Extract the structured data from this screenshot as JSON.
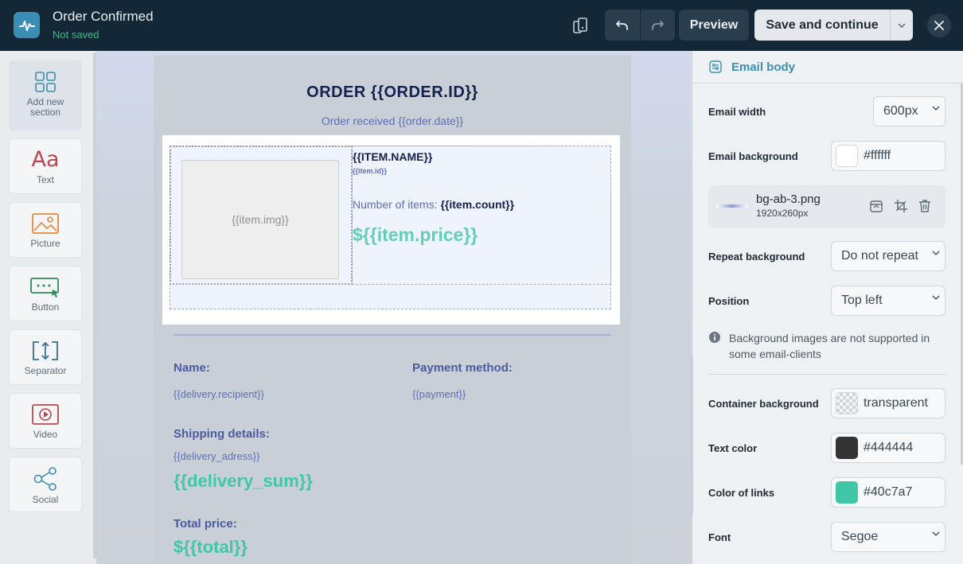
{
  "header": {
    "title": "Order Confirmed",
    "status": "Not saved",
    "preview_label": "Preview",
    "save_label": "Save and continue"
  },
  "sidebar": {
    "items": [
      {
        "label": "Add new section",
        "icon": "grid-icon"
      },
      {
        "label": "Text",
        "icon": "text-aa-icon"
      },
      {
        "label": "Picture",
        "icon": "picture-icon"
      },
      {
        "label": "Button",
        "icon": "button-icon"
      },
      {
        "label": "Separator",
        "icon": "separator-icon"
      },
      {
        "label": "Video",
        "icon": "video-icon"
      },
      {
        "label": "Social",
        "icon": "share-icon"
      }
    ]
  },
  "email": {
    "order_title": "ORDER {{ORDER.ID}}",
    "order_date": "Order received {{order.date}}",
    "item_img": "{{item.img}}",
    "item_name": "{{ITEM.NAME}}",
    "item_id": "{{item.id}}",
    "item_count_label": "Number of items:",
    "item_count_value": "{{item.count}}",
    "item_price": "${{item.price}}",
    "name_label": "Name:",
    "name_value": "{{delivery.recipient}}",
    "payment_label": "Payment method:",
    "payment_value": "{{payment}}",
    "shipping_label": "Shipping details:",
    "shipping_value": "{{delivery_adress}}",
    "delivery_sum": "{{delivery_sum}}",
    "total_label": "Total price:",
    "total_value": "${{total}}"
  },
  "panel": {
    "title": "Email body",
    "width_label": "Email width",
    "width_value": "600px",
    "background_label": "Email background",
    "background_value": "#ffffff",
    "bg_file_name": "bg-ab-3.png",
    "bg_file_size": "1920x260px",
    "repeat_label": "Repeat background",
    "repeat_value": "Do not repeat",
    "position_label": "Position",
    "position_value": "Top left",
    "note": "Background images are not supported in some email-clients",
    "container_label": "Container background",
    "container_value": "transparent",
    "text_color_label": "Text color",
    "text_color_value": "#444444",
    "link_color_label": "Color of links",
    "link_color_value": "#40c7a7",
    "font_label": "Font",
    "font_value": "Segoe"
  },
  "colors": {
    "accent": "#3d8eaf",
    "saved_status": "#35c07a",
    "text_swatch": "#333333",
    "link_swatch": "#40c7a7",
    "price": "#40c7a7"
  }
}
